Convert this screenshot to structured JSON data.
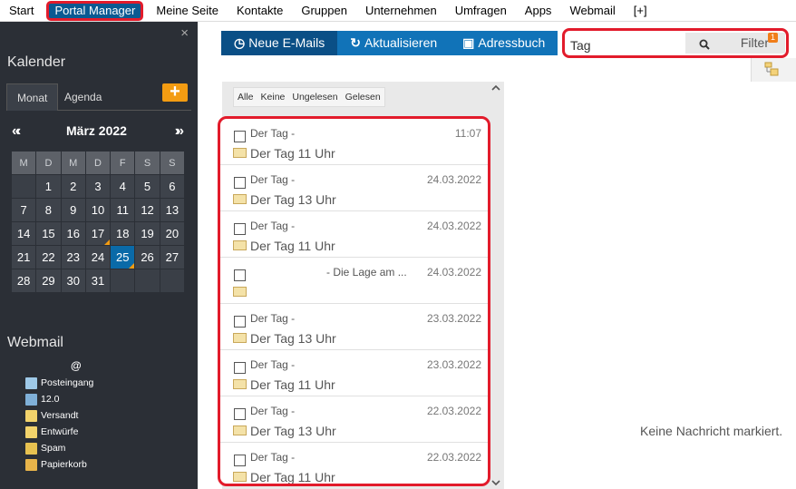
{
  "topnav": {
    "items": [
      "Start",
      "Portal Manager",
      "Meine Seite",
      "Kontakte",
      "Gruppen",
      "Unternehmen",
      "Umfragen",
      "Apps",
      "Webmail",
      "[+]"
    ],
    "active_index": 1
  },
  "sidebar": {
    "close_glyph": "×",
    "calendar_title": "Kalender",
    "tabs": [
      "Monat",
      "Agenda"
    ],
    "add_glyph": "+",
    "month_label": "März 2022",
    "prev_glyph": "«‹",
    "next_glyph": "›»",
    "weekdays": [
      "M",
      "D",
      "M",
      "D",
      "F",
      "S",
      "S"
    ],
    "weeks": [
      [
        "",
        "1",
        "2",
        "3",
        "4",
        "5",
        "6"
      ],
      [
        "7",
        "8",
        "9",
        "10",
        "11",
        "12",
        "13"
      ],
      [
        "14",
        "15",
        "16",
        "17",
        "18",
        "19",
        "20"
      ],
      [
        "21",
        "22",
        "23",
        "24",
        "25",
        "26",
        "27"
      ],
      [
        "28",
        "29",
        "30",
        "31",
        "",
        "",
        ""
      ]
    ],
    "today": "25",
    "marked_days": [
      "17",
      "25"
    ],
    "webmail_title": "Webmail",
    "account_label": "@",
    "folders": [
      {
        "label": "Posteingang",
        "icon": "inbox-icon",
        "color": "#9ec9e8"
      },
      {
        "label": "12.0",
        "icon": "folder-icon",
        "color": "#7fb0d8"
      },
      {
        "label": "Versandt",
        "icon": "sent-icon",
        "color": "#f2d36b"
      },
      {
        "label": "Entwürfe",
        "icon": "drafts-icon",
        "color": "#f2d36b"
      },
      {
        "label": "Spam",
        "icon": "spam-icon",
        "color": "#e7c150"
      },
      {
        "label": "Papierkorb",
        "icon": "trash-icon",
        "color": "#e8b44a"
      }
    ]
  },
  "toolbar": {
    "new_mails": {
      "icon": "clock-icon",
      "label": "Neue E-Mails",
      "color": "#0a4f86"
    },
    "refresh": {
      "icon": "refresh-icon",
      "label": "Aktualisieren",
      "color": "#1173b8"
    },
    "addressbook": {
      "icon": "book-icon",
      "label": "Adressbuch",
      "color": "#1173b8"
    }
  },
  "search": {
    "value": "Tag",
    "filter_label": "Filter",
    "filter_badge": "1"
  },
  "filter_bar": [
    "Alle",
    "Keine",
    "Ungelesen",
    "Gelesen"
  ],
  "mails": [
    {
      "from": "Der Tag -",
      "date": "11:07",
      "subject": "Der Tag 11 Uhr"
    },
    {
      "from": "Der Tag -",
      "date": "24.03.2022",
      "subject": "Der Tag 13 Uhr"
    },
    {
      "from": "Der Tag -",
      "date": "24.03.2022",
      "subject": "Der Tag 11 Uhr"
    },
    {
      "from": "- Die Lage am ...",
      "date": "24.03.2022",
      "subject": ""
    },
    {
      "from": "Der Tag -",
      "date": "23.03.2022",
      "subject": "Der Tag 13 Uhr"
    },
    {
      "from": "Der Tag -",
      "date": "23.03.2022",
      "subject": "Der Tag 11 Uhr"
    },
    {
      "from": "Der Tag -",
      "date": "22.03.2022",
      "subject": "Der Tag 13 Uhr"
    },
    {
      "from": "Der Tag -",
      "date": "22.03.2022",
      "subject": "Der Tag 11 Uhr"
    }
  ],
  "preview": {
    "empty_text": "Keine Nachricht markiert."
  }
}
